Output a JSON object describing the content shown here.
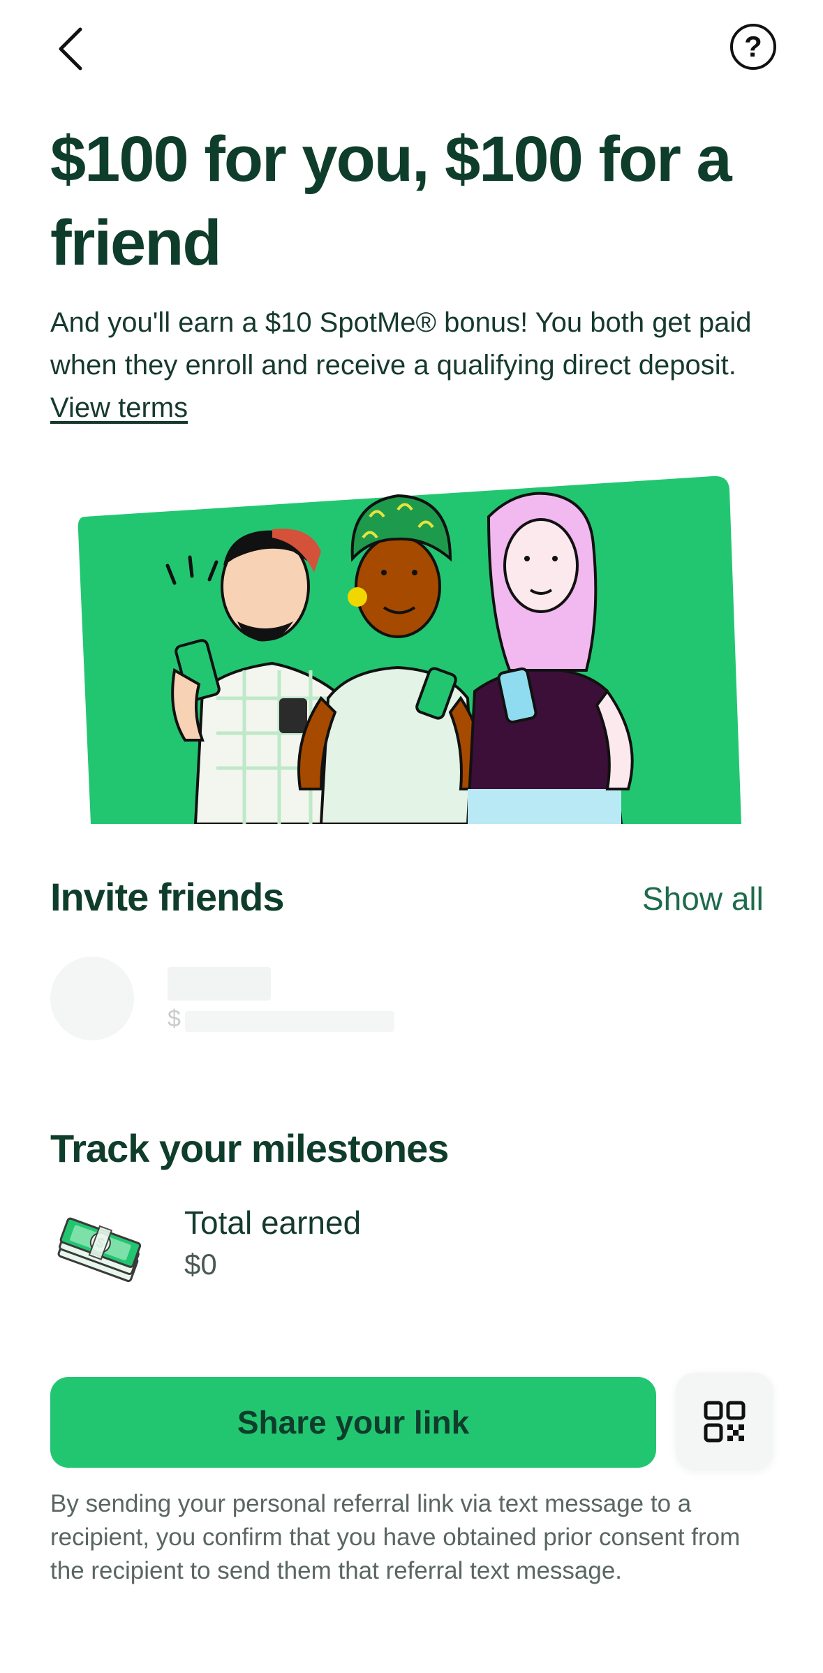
{
  "header": {
    "back_icon": "chevron-left-icon",
    "help_icon": "question-circle-icon",
    "help_glyph": "?"
  },
  "hero": {
    "title": "$100 for you, $100 for a friend",
    "subtitle": "And you'll earn a $10 SpotMe® bonus! You both get paid when they enroll and receive a qualifying direct deposit.",
    "terms_link": "View terms"
  },
  "colors": {
    "brand_green": "#22c671",
    "dark_green": "#0f3d2b",
    "link_green": "#1e6b4c"
  },
  "invite": {
    "title": "Invite friends",
    "show_all": "Show all",
    "placeholder_currency": "$"
  },
  "milestones": {
    "title": "Track your milestones",
    "total_label": "Total earned",
    "total_value": "$0",
    "icon": "money-stack-icon"
  },
  "actions": {
    "share_label": "Share your link",
    "qr_icon": "qr-code-icon"
  },
  "disclaimer": "By sending your personal referral link via text message to a recipient, you confirm that you have obtained prior consent from the recipient to send them that referral text message."
}
